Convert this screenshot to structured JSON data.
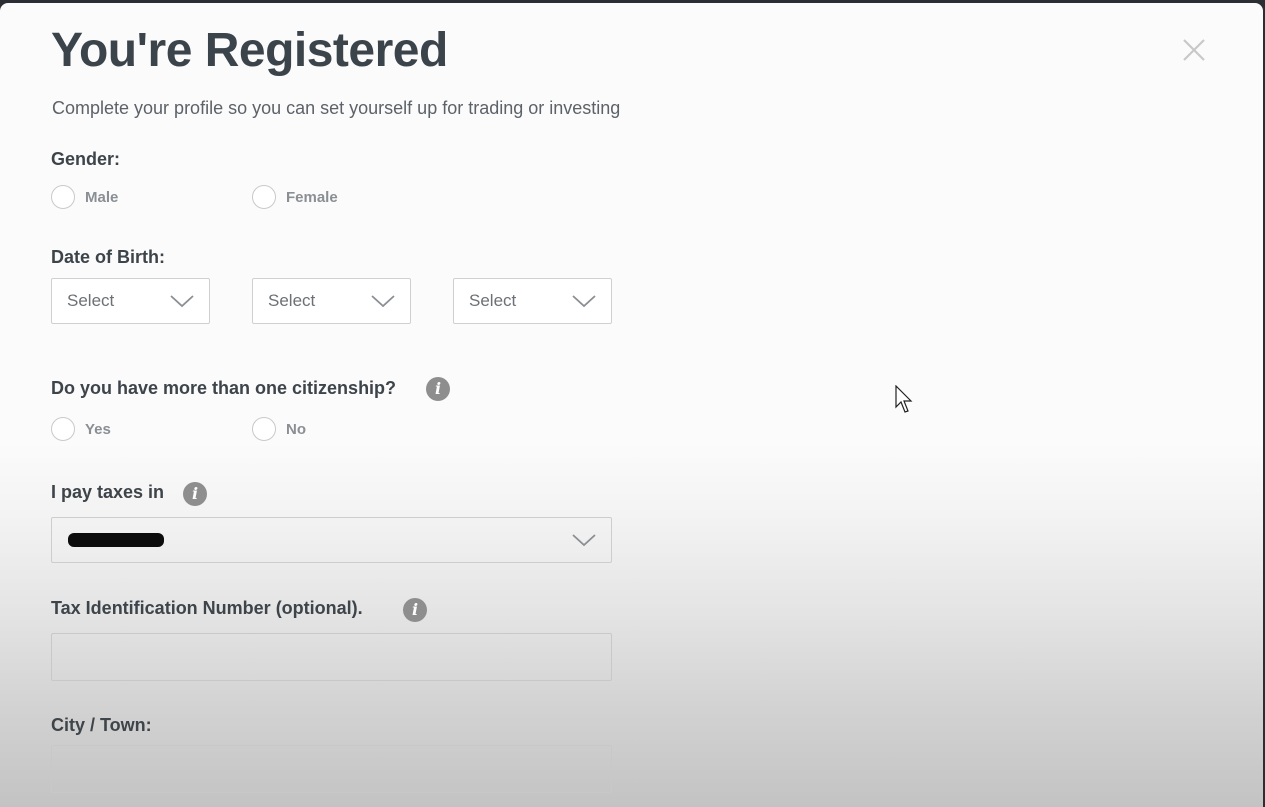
{
  "modal": {
    "title": "You're Registered",
    "subtitle": "Complete your profile so you can set yourself up for trading or investing",
    "close_icon": "close-icon"
  },
  "gender": {
    "label": "Gender:",
    "options": [
      {
        "label": "Male",
        "selected": false
      },
      {
        "label": "Female",
        "selected": false
      }
    ]
  },
  "date_of_birth": {
    "label": "Date of Birth:",
    "selects": [
      {
        "value": "Select"
      },
      {
        "value": "Select"
      },
      {
        "value": "Select"
      }
    ]
  },
  "citizenship": {
    "label": "Do you have more than one citizenship?",
    "info_icon": "info-icon",
    "options": [
      {
        "label": "Yes",
        "selected": false
      },
      {
        "label": "No",
        "selected": false
      }
    ]
  },
  "taxes": {
    "label": "I pay taxes in",
    "info_icon": "info-icon",
    "value_redacted": true
  },
  "tin": {
    "label": "Tax Identification Number (optional).",
    "info_icon": "info-icon",
    "value": "",
    "placeholder": ""
  },
  "city": {
    "label": "City / Town:",
    "value": "",
    "placeholder": ""
  },
  "icons": {
    "info_glyph": "i"
  }
}
